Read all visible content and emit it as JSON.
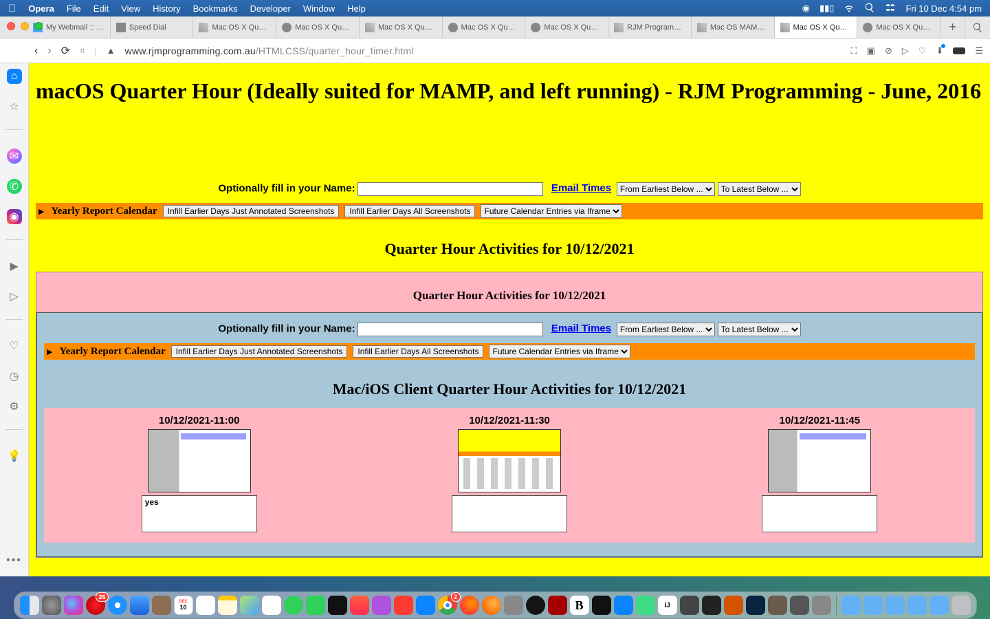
{
  "menubar": {
    "app": "Opera",
    "items": [
      "File",
      "Edit",
      "View",
      "History",
      "Bookmarks",
      "Developer",
      "Window",
      "Help"
    ],
    "clock": "Fri 10 Dec  4:54 pm"
  },
  "tabs": {
    "items": [
      {
        "label": "My Webmail :: We",
        "icon": "mail"
      },
      {
        "label": "Speed Dial",
        "icon": "grid"
      },
      {
        "label": "Mac OS X Quarte",
        "icon": "rocket"
      },
      {
        "label": "Mac OS X Quarte",
        "icon": "globe"
      },
      {
        "label": "Mac OS X Quarte",
        "icon": "rocket"
      },
      {
        "label": "Mac OS X Quarte",
        "icon": "globe"
      },
      {
        "label": "Mac OS X Quarte",
        "icon": "globe"
      },
      {
        "label": "RJM Programming",
        "icon": "rocket"
      },
      {
        "label": "Mac OS MAMP T",
        "icon": "rocket"
      },
      {
        "label": "Mac OS X Quarte",
        "icon": "rocket",
        "active": true
      },
      {
        "label": "Mac OS X Quarte",
        "icon": "globe"
      }
    ]
  },
  "address": {
    "host": "www.rjmprogramming.com.au",
    "path": "/HTMLCSS/quarter_hour_timer.html"
  },
  "page": {
    "title": "macOS Quarter Hour (Ideally suited for MAMP, and left running) - RJM Programming - June, 2016",
    "name_label": "Optionally fill in your Name:",
    "email_times": "Email Times",
    "from_opt": "From Earliest Below ...",
    "to_opt": "To Latest Below ...",
    "yrc": "Yearly Report Calendar",
    "btn_ann": "Infill Earlier Days Just Annotated Screenshots",
    "btn_all": "Infill Earlier Days All Screenshots",
    "future_opt": "Future Calendar Entries via Iframe",
    "qha_heading": "Quarter Hour Activities for 10/12/2021",
    "inner_heading": "Quarter Hour Activities for 10/12/2021",
    "client_heading": "Mac/iOS Client Quarter Hour Activities for 10/12/2021",
    "thumbs": [
      {
        "time": "10/12/2021-11:00",
        "note": "yes",
        "style": "va"
      },
      {
        "time": "10/12/2021-11:30",
        "note": "",
        "style": "vb"
      },
      {
        "time": "10/12/2021-11:45",
        "note": "",
        "style": "vc"
      }
    ]
  },
  "dock": {
    "cal_month": "DEC",
    "cal_day": "10",
    "opera_badge": "26",
    "chrome_badge": "2"
  }
}
